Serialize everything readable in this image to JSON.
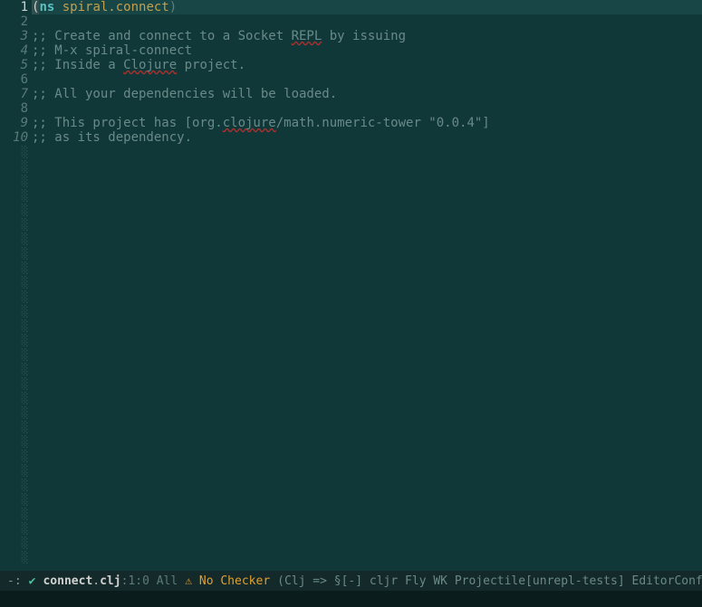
{
  "code": {
    "lines": [
      {
        "num": "1",
        "current": true,
        "italic": false,
        "segments": [
          {
            "cls": "paren-open",
            "text": "("
          },
          {
            "cls": "keyword",
            "text": "ns"
          },
          {
            "cls": "",
            "text": " "
          },
          {
            "cls": "ns-name",
            "text": "spiral.connect"
          },
          {
            "cls": "paren-close",
            "text": ")"
          }
        ],
        "hl": true
      },
      {
        "num": "2",
        "current": false,
        "italic": false,
        "segments": []
      },
      {
        "num": "3",
        "current": false,
        "italic": true,
        "segments": [
          {
            "cls": "comment",
            "text": ";; Create and connect to a Socket "
          },
          {
            "cls": "comment wavy",
            "text": "REPL"
          },
          {
            "cls": "comment",
            "text": " by issuing"
          }
        ]
      },
      {
        "num": "4",
        "current": false,
        "italic": true,
        "segments": [
          {
            "cls": "comment",
            "text": ";; M-x spiral-connect"
          }
        ]
      },
      {
        "num": "5",
        "current": false,
        "italic": true,
        "segments": [
          {
            "cls": "comment",
            "text": ";; Inside a "
          },
          {
            "cls": "comment wavy",
            "text": "Clojure"
          },
          {
            "cls": "comment",
            "text": " project."
          }
        ]
      },
      {
        "num": "6",
        "current": false,
        "italic": false,
        "segments": []
      },
      {
        "num": "7",
        "current": false,
        "italic": true,
        "segments": [
          {
            "cls": "comment",
            "text": ";; All your dependencies will be loaded."
          }
        ]
      },
      {
        "num": "8",
        "current": false,
        "italic": false,
        "segments": []
      },
      {
        "num": "9",
        "current": false,
        "italic": true,
        "segments": [
          {
            "cls": "comment",
            "text": ";; This project has [org."
          },
          {
            "cls": "comment wavy",
            "text": "clojure"
          },
          {
            "cls": "comment",
            "text": "/math.numeric-tower \"0.0.4\"]"
          }
        ]
      },
      {
        "num": "10",
        "current": false,
        "italic": true,
        "segments": [
          {
            "cls": "comment",
            "text": ";; as its dependency."
          }
        ]
      }
    ],
    "empty_marker": "░"
  },
  "modeline": {
    "left_indicator": "-:",
    "check_icon": "✔",
    "filename_base": "connect",
    "filename_dot": ".",
    "filename_ext": "clj",
    "position": ":1:0 All",
    "warn_icon": "⚠",
    "warn_text": "No Checker",
    "modes": "(Clj => §[-] cljr Fly WK Projectile[unrepl-tests] EditorConfig"
  }
}
